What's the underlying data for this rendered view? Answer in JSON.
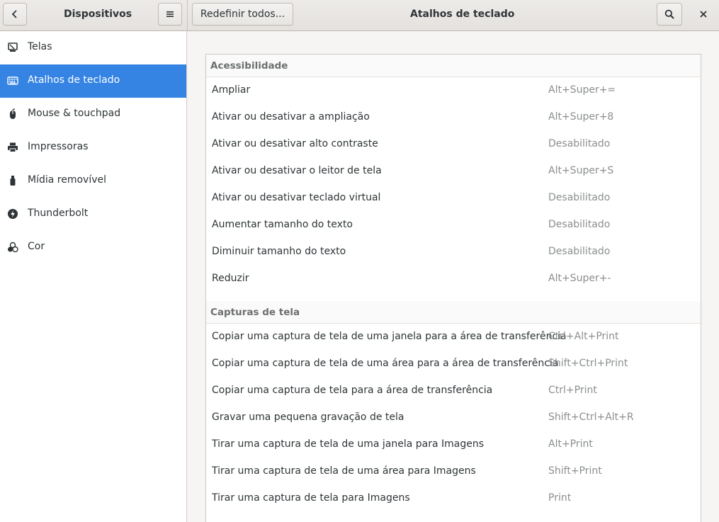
{
  "header": {
    "left_title": "Dispositivos",
    "reset_label": "Redefinir todos...",
    "center_title": "Atalhos de teclado"
  },
  "sidebar": {
    "items": [
      {
        "label": "Telas",
        "icon": "display-icon"
      },
      {
        "label": "Atalhos de teclado",
        "icon": "keyboard-icon",
        "active": true
      },
      {
        "label": "Mouse & touchpad",
        "icon": "mouse-icon"
      },
      {
        "label": "Impressoras",
        "icon": "printer-icon"
      },
      {
        "label": "Mídia removível",
        "icon": "usb-drive-icon"
      },
      {
        "label": "Thunderbolt",
        "icon": "thunderbolt-icon"
      },
      {
        "label": "Cor",
        "icon": "color-icon"
      }
    ]
  },
  "sections": [
    {
      "title": "Acessibilidade",
      "rows": [
        {
          "name": "Ampliar",
          "accel": "Alt+Super+="
        },
        {
          "name": "Ativar ou desativar a ampliação",
          "accel": "Alt+Super+8"
        },
        {
          "name": "Ativar ou desativar alto contraste",
          "accel": "Desabilitado"
        },
        {
          "name": "Ativar ou desativar o leitor de tela",
          "accel": "Alt+Super+S"
        },
        {
          "name": "Ativar ou desativar teclado virtual",
          "accel": "Desabilitado"
        },
        {
          "name": "Aumentar tamanho do texto",
          "accel": "Desabilitado"
        },
        {
          "name": "Diminuir tamanho do texto",
          "accel": "Desabilitado"
        },
        {
          "name": "Reduzir",
          "accel": "Alt+Super+-"
        }
      ]
    },
    {
      "title": "Capturas de tela",
      "rows": [
        {
          "name": "Copiar uma captura de tela de uma janela para a área de transferência",
          "accel": "Ctrl+Alt+Print"
        },
        {
          "name": "Copiar uma captura de tela de uma área para a área de transferência",
          "accel": "Shift+Ctrl+Print"
        },
        {
          "name": "Copiar uma captura de tela para a área de transferência",
          "accel": "Ctrl+Print"
        },
        {
          "name": "Gravar uma pequena gravação de tela",
          "accel": "Shift+Ctrl+Alt+R"
        },
        {
          "name": "Tirar uma captura de tela de uma janela para Imagens",
          "accel": "Alt+Print"
        },
        {
          "name": "Tirar uma captura de tela de uma área para Imagens",
          "accel": "Shift+Print"
        },
        {
          "name": "Tirar uma captura de tela para Imagens",
          "accel": "Print"
        }
      ]
    }
  ],
  "colors": {
    "accent": "#3584e4"
  }
}
